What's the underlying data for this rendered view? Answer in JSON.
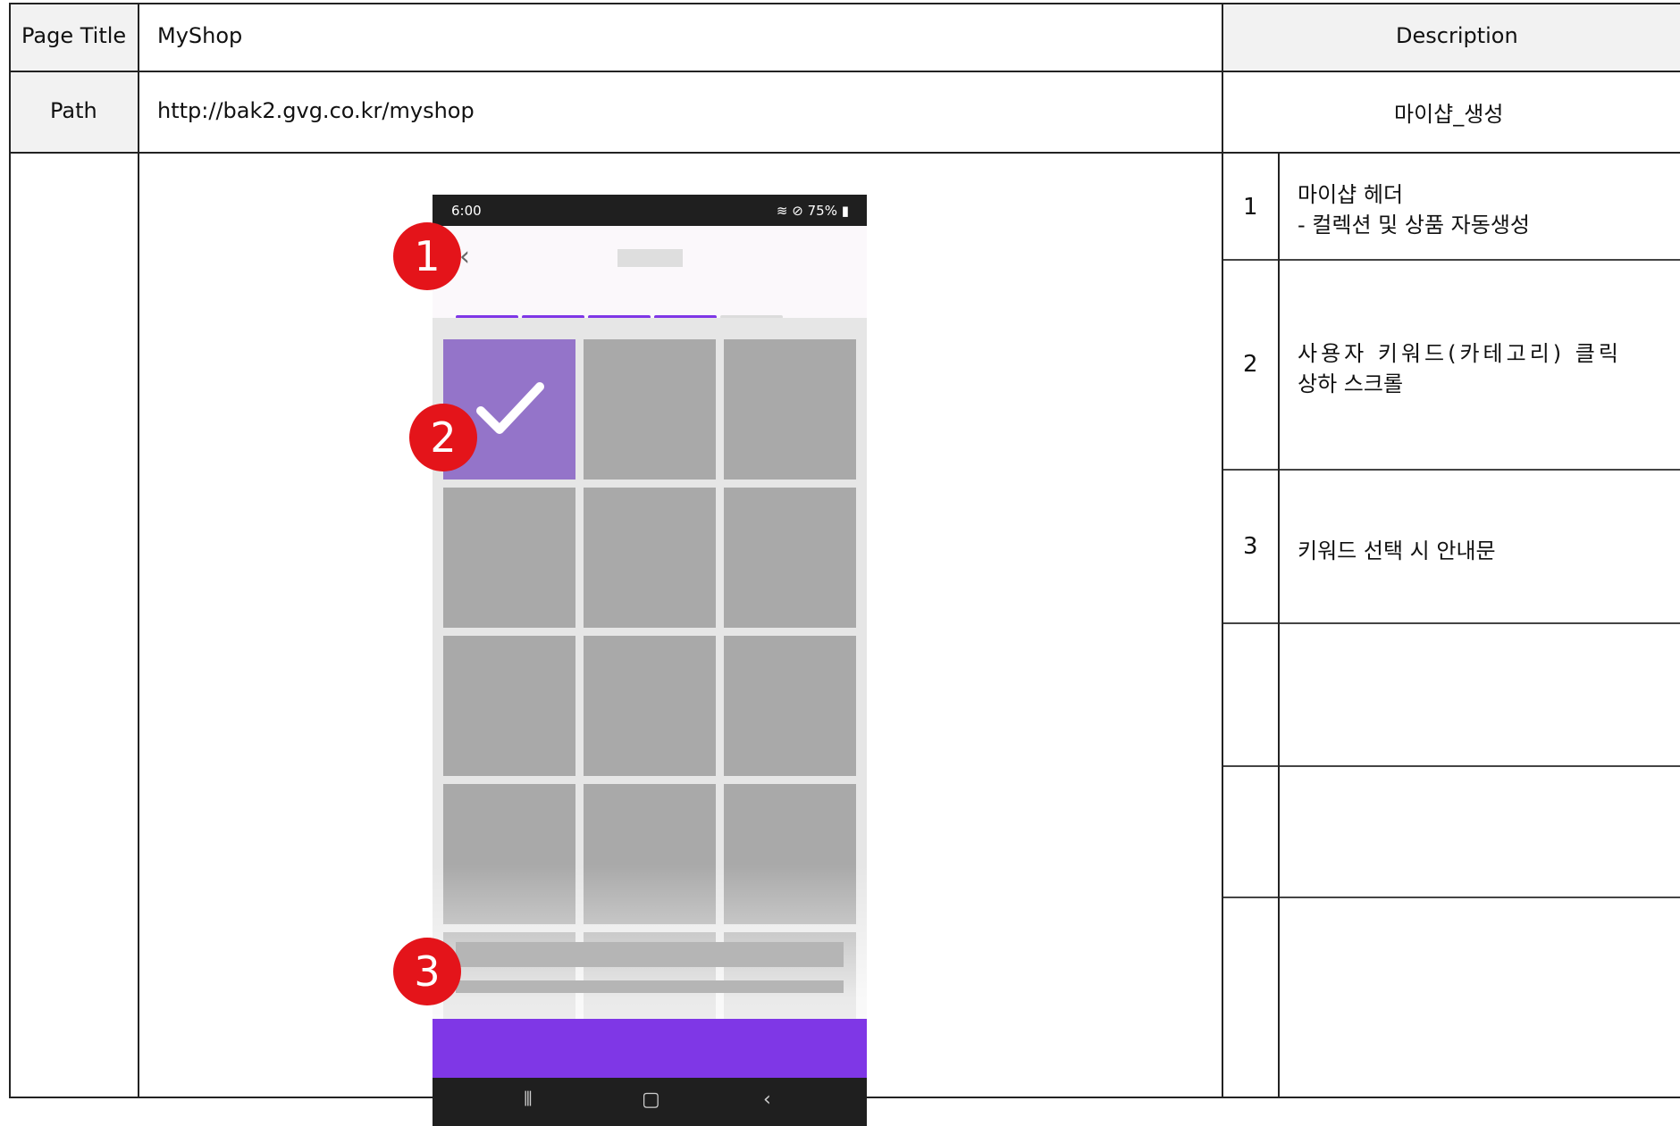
{
  "header": {
    "page_title_label": "Page Title",
    "page_title_value": "MyShop",
    "description_label": "Description",
    "path_label": "Path",
    "path_value": "http://bak2.gvg.co.kr/myshop",
    "description_value": "마이샵_생성"
  },
  "descriptions": [
    {
      "num": "1",
      "line1": "마이샵 헤더",
      "line2": "- 컬렉션 및 상품 자동생성"
    },
    {
      "num": "2",
      "line1": "사용자 키워드(카테고리) 클릭",
      "line2": "상하 스크롤"
    },
    {
      "num": "3",
      "line1": "키워드 선택 시 안내문",
      "line2": ""
    }
  ],
  "phone": {
    "status_time": "6:00",
    "status_battery": "75%",
    "progress_steps_done": 4,
    "progress_steps_total": 5,
    "selected_tile_index": 0
  },
  "markers": [
    "1",
    "2",
    "3"
  ],
  "colors": {
    "accent": "#7f37e6",
    "selected_tile": "#9474c9",
    "marker": "#e4141a",
    "progress_inactive": "#dcdcdc"
  },
  "icons": {
    "back": "chevron-left-icon",
    "check": "check-icon",
    "wifi": "wifi-icon",
    "nav_recent": "recent-apps-icon",
    "nav_home": "home-icon",
    "nav_back": "back-icon"
  }
}
